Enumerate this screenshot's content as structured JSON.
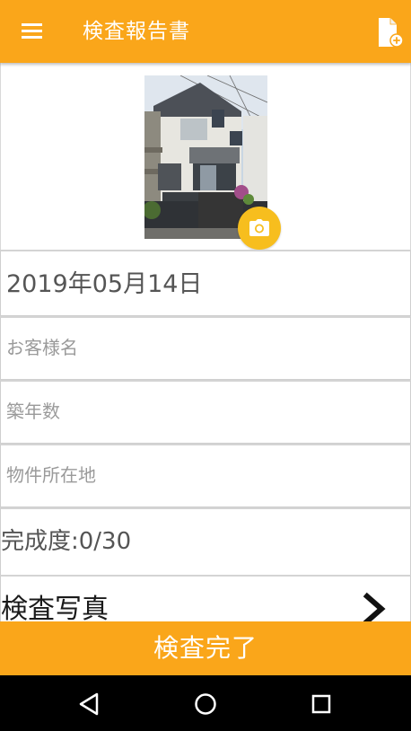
{
  "toolbar": {
    "title": "検査報告書"
  },
  "icons": {
    "menu": "menu-icon",
    "new_report": "file-add-icon",
    "camera": "camera-icon",
    "next": "chevron-right-icon",
    "nav_back": "triangle-back-icon",
    "nav_home": "circle-home-icon",
    "nav_recents": "square-recents-icon"
  },
  "report": {
    "date": "2019年05月14日",
    "customer_name": {
      "value": "",
      "placeholder": "お客様名"
    },
    "building_age": {
      "value": "",
      "placeholder": "築年数"
    },
    "property_address": {
      "value": "",
      "placeholder": "物件所在地"
    },
    "completion": "完成度:0/30",
    "photos_label": "検査写真"
  },
  "footer": {
    "complete_label": "検査完了"
  },
  "colors": {
    "accent": "#FAA61A",
    "camera_button": "#F7BE1E",
    "navbar": "#000000",
    "divider": "#d4d4d4"
  }
}
